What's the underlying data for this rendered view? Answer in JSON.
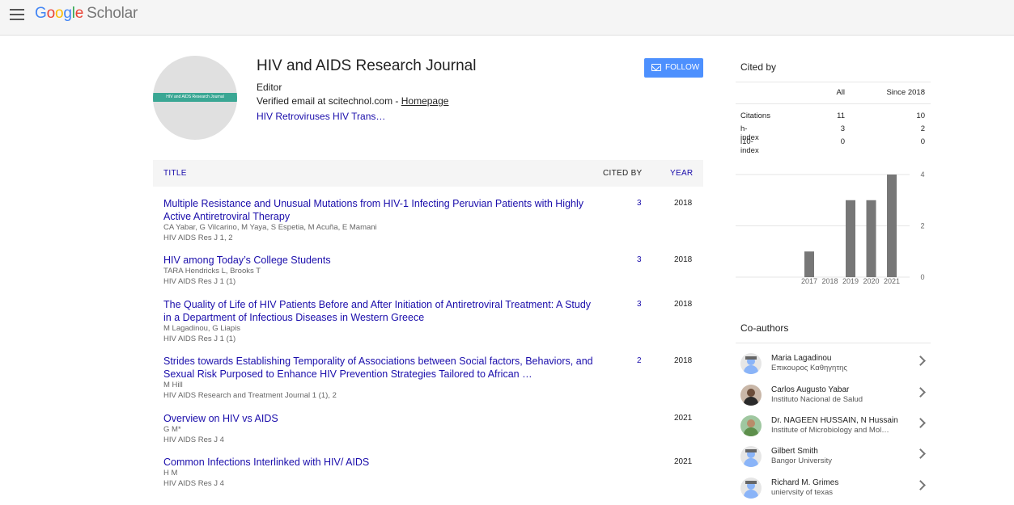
{
  "header": {
    "logo_google": [
      "G",
      "o",
      "o",
      "g",
      "l",
      "e"
    ],
    "logo_scholar": "Scholar"
  },
  "profile": {
    "avatar_band_text": "HIV and AIDS Research Journal",
    "name": "HIV and AIDS Research Journal",
    "affiliation": "Editor",
    "email_text": "Verified email at scitechnol.com - ",
    "homepage_label": "Homepage",
    "interests": "HIV Retroviruses HIV Trans…",
    "follow_label": "FOLLOW"
  },
  "table": {
    "headers": {
      "title": "TITLE",
      "cited_by": "CITED BY",
      "year": "YEAR"
    },
    "rows": [
      {
        "title": "Multiple Resistance and Unusual Mutations from HIV-1 Infecting Peruvian Patients with Highly Active Antiretroviral Therapy",
        "authors": "CA Yabar, G Vilcarino, M Yaya, S Espetia, M Acuña, E Mamani",
        "venue": "HIV AIDS Res J 1, 2",
        "cited": "3",
        "year": "2018"
      },
      {
        "title": "HIV among Today’s College Students",
        "authors": "TARA Hendricks L, Brooks T",
        "venue": "HIV AIDS Res J 1 (1)",
        "cited": "3",
        "year": "2018"
      },
      {
        "title": "The Quality of Life of HIV Patients Before and After Initiation of Antiretroviral Treatment: A Study in a Department of Infectious Diseases in Western Greece",
        "authors": "M Lagadinou, G Liapis",
        "venue": "HIV AIDS Res J 1 (1)",
        "cited": "3",
        "year": "2018"
      },
      {
        "title": "Strides towards Establishing Temporality of Associations between Social factors, Behaviors, and Sexual Risk Purposed to Enhance HIV Prevention Strategies Tailored to African …",
        "authors": "M Hill",
        "venue": "HIV AIDS Research and Treatment Journal 1 (1), 2",
        "cited": "2",
        "year": "2018"
      },
      {
        "title": "Overview on HIV vs AIDS",
        "authors": "G M*",
        "venue": "HIV AIDS Res J 4",
        "cited": "",
        "year": "2021"
      },
      {
        "title": "Common Infections Interlinked with HIV/ AIDS",
        "authors": "H M",
        "venue": "HIV AIDS Res J 4",
        "cited": "",
        "year": "2021"
      }
    ]
  },
  "cited_by": {
    "title": "Cited by",
    "col_all": "All",
    "col_since": "Since 2018",
    "rows": [
      {
        "label": "Citations",
        "all": "11",
        "since": "10"
      },
      {
        "label": "h-index",
        "all": "3",
        "since": "2"
      },
      {
        "label": "i10-index",
        "all": "0",
        "since": "0"
      }
    ]
  },
  "chart_data": {
    "type": "bar",
    "categories": [
      "2017",
      "2018",
      "2019",
      "2020",
      "2021"
    ],
    "values": [
      1,
      0,
      3,
      3,
      4
    ],
    "ylim": [
      0,
      4
    ],
    "yticks": [
      0,
      2,
      4
    ],
    "grid": true,
    "color": "#777777"
  },
  "coauthors": {
    "title": "Co-authors",
    "items": [
      {
        "name": "Maria Lagadinou",
        "affiliation": "Επικουρος Καθηγητης",
        "avatar": "default"
      },
      {
        "name": "Carlos Augusto Yabar",
        "affiliation": "Instituto Nacional de Salud",
        "avatar": "photo1"
      },
      {
        "name": "Dr. NAGEEN HUSSAIN, N Hussain",
        "affiliation": "Institute of Microbiology and Mol…",
        "avatar": "photo2"
      },
      {
        "name": "Gilbert Smith",
        "affiliation": "Bangor University",
        "avatar": "default"
      },
      {
        "name": "Richard M. Grimes",
        "affiliation": "uniervsity of texas",
        "avatar": "default"
      }
    ]
  }
}
